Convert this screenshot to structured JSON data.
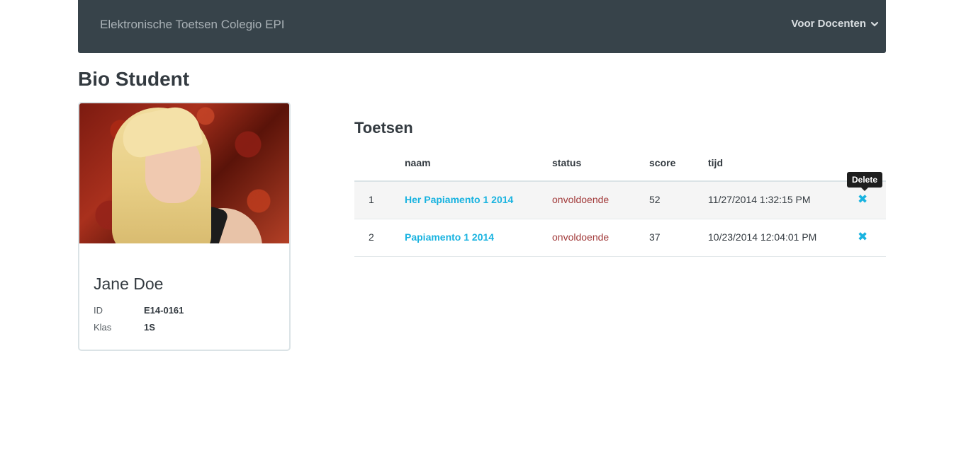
{
  "navbar": {
    "brand": "Elektronische Toetsen Colegio EPI",
    "menu_label": "Voor Docenten",
    "menu_icon": "chevron-down-icon"
  },
  "page": {
    "title": "Bio Student"
  },
  "student": {
    "name": "Jane Doe",
    "fields": {
      "id_label": "ID",
      "id_value": "E14-0161",
      "klas_label": "Klas",
      "klas_value": "1S"
    }
  },
  "tests": {
    "title": "Toetsen",
    "columns": {
      "naam": "naam",
      "status": "status",
      "score": "score",
      "tijd": "tijd"
    },
    "rows": [
      {
        "num": "1",
        "naam": "Her Papiamento 1 2014",
        "status": "onvoldoende",
        "score": "52",
        "tijd": "11/27/2014 1:32:15 PM"
      },
      {
        "num": "2",
        "naam": "Papiamento 1 2014",
        "status": "onvoldoende",
        "score": "37",
        "tijd": "10/23/2014 12:04:01 PM"
      }
    ],
    "delete_icon": "✖",
    "tooltip": "Delete"
  },
  "colors": {
    "navbar_bg": "#37434a",
    "link": "#19b3e0",
    "status_fail": "#a23b3b"
  }
}
